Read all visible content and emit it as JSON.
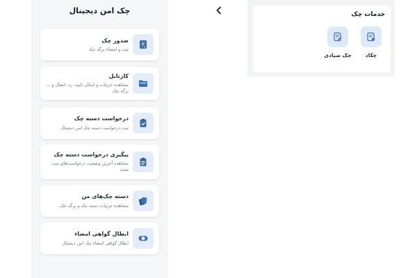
{
  "drawer": {
    "title": "چک امن دیجیتال",
    "items": [
      {
        "title": "صدور چک",
        "description": "ثبت و امضاء برگه چک",
        "icon": "sign-document-icon"
      },
      {
        "title": "کارتابل",
        "description": "مشاهده جزئیات و امکان تایید، رد، انتقال و ... برگه چک",
        "icon": "folder-icon"
      },
      {
        "title": "درخواست دسته چک",
        "description": "ثبت درخواست دسته چک امن دیجیتال",
        "icon": "clipboard-check-icon"
      },
      {
        "title": "پیگیری درخواست دسته چک",
        "description": "مشاهده آخرین وضعیت درخواست‌های ثبت شده",
        "icon": "clipboard-list-icon"
      },
      {
        "title": "دسته چک‌های من",
        "description": "مشاهده جزئیات دسته چک و برگه چک.",
        "icon": "cheque-book-icon"
      },
      {
        "title": "ابطال گواهی امضاء",
        "description": "ابطال گواهی امضاء چک امن دیجیتال",
        "icon": "revoke-toggle-icon"
      }
    ]
  },
  "chevron_icon": "chevron-left-icon",
  "services": {
    "title": "خدمات چک",
    "items": [
      {
        "label": "چکاد",
        "icon": "chakad-document-icon"
      },
      {
        "label": "چک صیادی",
        "icon": "sayadi-cheque-icon"
      }
    ]
  },
  "colors": {
    "accent": "#3f6fb0",
    "icon_bg": "#e3ecf8",
    "drawer_bg": "#f5f6f8"
  }
}
